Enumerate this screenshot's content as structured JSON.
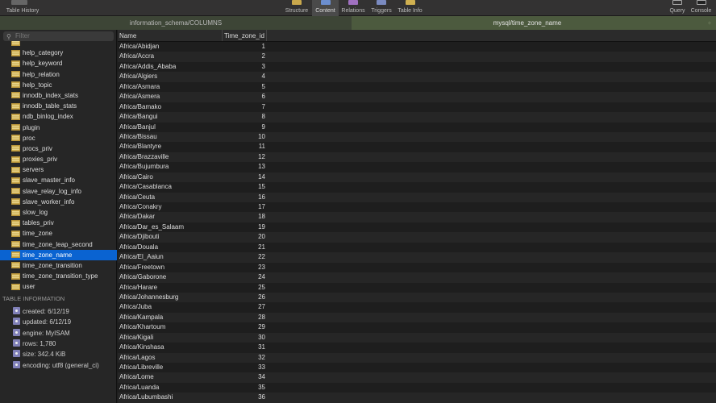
{
  "toolbar": {
    "table_history": "Table History",
    "structure": "Structure",
    "content": "Content",
    "relations": "Relations",
    "triggers": "Triggers",
    "table_info": "Table Info",
    "query": "Query",
    "console": "Console"
  },
  "tabs": [
    {
      "label": "information_schema/COLUMNS"
    },
    {
      "label": "mysql/time_zone_name"
    }
  ],
  "add_tab": "+",
  "sidebar": {
    "filter_placeholder": "Filter",
    "tables": [
      "help_category",
      "help_keyword",
      "help_relation",
      "help_topic",
      "innodb_index_stats",
      "innodb_table_stats",
      "ndb_binlog_index",
      "plugin",
      "proc",
      "procs_priv",
      "proxies_priv",
      "servers",
      "slave_master_info",
      "slave_relay_log_info",
      "slave_worker_info",
      "slow_log",
      "tables_priv",
      "time_zone",
      "time_zone_leap_second",
      "time_zone_name",
      "time_zone_transition",
      "time_zone_transition_type",
      "user"
    ],
    "selected": "time_zone_name"
  },
  "table_info": {
    "header": "TABLE INFORMATION",
    "items": [
      "created: 6/12/19",
      "updated: 6/12/19",
      "engine: MyISAM",
      "rows: 1,780",
      "size: 342.4 KiB",
      "encoding: utf8 (general_ci)"
    ]
  },
  "grid": {
    "columns": [
      "Name",
      "Time_zone_id"
    ],
    "rows": [
      [
        "Africa/Abidjan",
        "1"
      ],
      [
        "Africa/Accra",
        "2"
      ],
      [
        "Africa/Addis_Ababa",
        "3"
      ],
      [
        "Africa/Algiers",
        "4"
      ],
      [
        "Africa/Asmara",
        "5"
      ],
      [
        "Africa/Asmera",
        "6"
      ],
      [
        "Africa/Bamako",
        "7"
      ],
      [
        "Africa/Bangui",
        "8"
      ],
      [
        "Africa/Banjul",
        "9"
      ],
      [
        "Africa/Bissau",
        "10"
      ],
      [
        "Africa/Blantyre",
        "11"
      ],
      [
        "Africa/Brazzaville",
        "12"
      ],
      [
        "Africa/Bujumbura",
        "13"
      ],
      [
        "Africa/Cairo",
        "14"
      ],
      [
        "Africa/Casablanca",
        "15"
      ],
      [
        "Africa/Ceuta",
        "16"
      ],
      [
        "Africa/Conakry",
        "17"
      ],
      [
        "Africa/Dakar",
        "18"
      ],
      [
        "Africa/Dar_es_Salaam",
        "19"
      ],
      [
        "Africa/Djibouti",
        "20"
      ],
      [
        "Africa/Douala",
        "21"
      ],
      [
        "Africa/El_Aaiun",
        "22"
      ],
      [
        "Africa/Freetown",
        "23"
      ],
      [
        "Africa/Gaborone",
        "24"
      ],
      [
        "Africa/Harare",
        "25"
      ],
      [
        "Africa/Johannesburg",
        "26"
      ],
      [
        "Africa/Juba",
        "27"
      ],
      [
        "Africa/Kampala",
        "28"
      ],
      [
        "Africa/Khartoum",
        "29"
      ],
      [
        "Africa/Kigali",
        "30"
      ],
      [
        "Africa/Kinshasa",
        "31"
      ],
      [
        "Africa/Lagos",
        "32"
      ],
      [
        "Africa/Libreville",
        "33"
      ],
      [
        "Africa/Lome",
        "34"
      ],
      [
        "Africa/Luanda",
        "35"
      ],
      [
        "Africa/Lubumbashi",
        "36"
      ]
    ]
  }
}
